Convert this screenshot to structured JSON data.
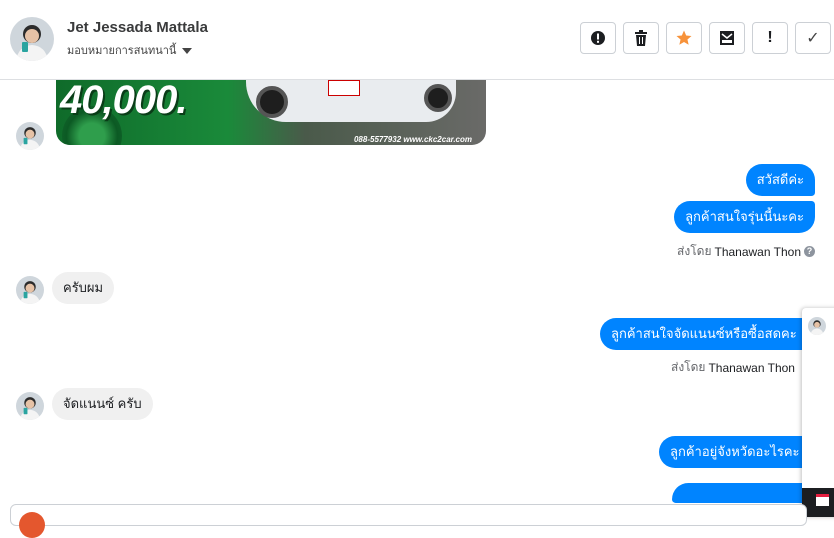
{
  "header": {
    "contact_name": "Jet Jessada Mattala",
    "assign_label": "มอบหมายการสนทนานี้",
    "actions": [
      {
        "name": "spam-icon",
        "glyph": "!"
      },
      {
        "name": "trash-icon",
        "glyph": ""
      },
      {
        "name": "star-icon",
        "glyph": "★"
      },
      {
        "name": "mark-unread-icon",
        "glyph": ""
      },
      {
        "name": "important-icon",
        "glyph": "!"
      },
      {
        "name": "check-icon",
        "glyph": "✓"
      }
    ]
  },
  "banner": {
    "price_text": "40,000.",
    "contact_text": "088-5577932 www.ckc2car.com"
  },
  "messages": {
    "m1": "สวัสดีค่ะ",
    "m2": "ลูกค้าสนใจรุ่นนี้นะคะ",
    "m3": "ครับผม",
    "m4": "ลูกค้าสนใจจัดแนนซ์หรือซื้อสดคะ",
    "m5": "จัดแนนซ์ ครับ",
    "m6": "ลูกค้าอยู่จังหวัดอะไรคะ"
  },
  "sent_by": {
    "prefix": "ส่งโดย",
    "agent": "Thanawan Thon",
    "help_glyph": "?"
  },
  "colors": {
    "outgoing_bubble": "#0084ff",
    "incoming_bubble": "#f0f0f0",
    "star": "#f7923a"
  }
}
